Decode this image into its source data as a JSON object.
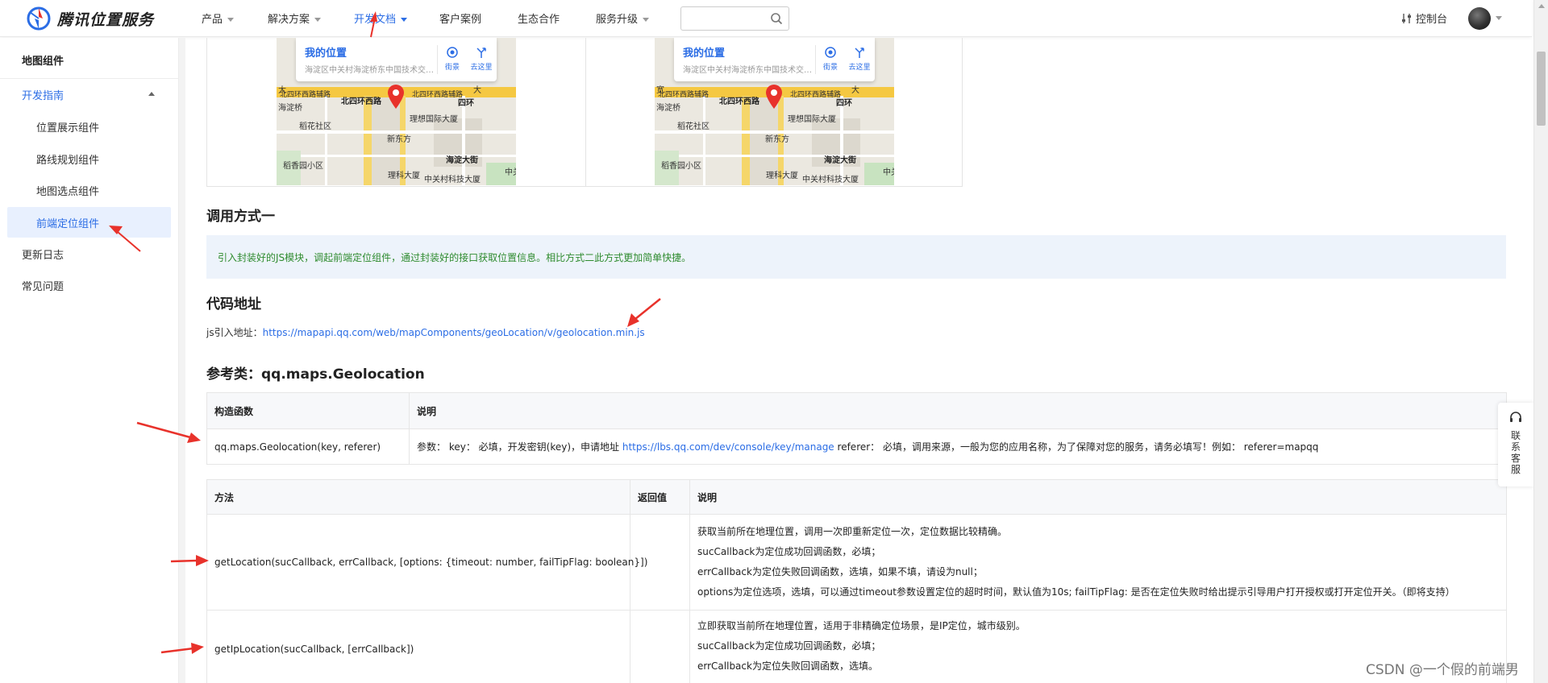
{
  "brand": {
    "name": "腾讯位置服务"
  },
  "nav": {
    "items": [
      {
        "label": "产品",
        "caret": true
      },
      {
        "label": "解决方案",
        "caret": true
      },
      {
        "label": "开发文档",
        "caret": true,
        "active": true
      },
      {
        "label": "客户案例",
        "caret": false
      },
      {
        "label": "生态合作",
        "caret": false
      },
      {
        "label": "服务升级",
        "caret": true
      }
    ],
    "search": {
      "value": "",
      "placeholder": ""
    },
    "console_label": "控制台"
  },
  "sidebar": {
    "title": "地图组件",
    "group": "开发指南",
    "items": [
      "位置展示组件",
      "路线规划组件",
      "地图选点组件",
      "前端定位组件"
    ],
    "active_item": "前端定位组件",
    "bottom_items": [
      "更新日志",
      "常见问题"
    ]
  },
  "maps": [
    {
      "card_title": "我的位置",
      "card_address": "海淀区中关村海淀桥东中国技术交易大厦",
      "btn_street": "街景",
      "btn_go": "去这里",
      "labels": {
        "road_north": "北四环西路辅路",
        "road_north2": "北四环西路辅路",
        "ring": "四环",
        "haidian_bridge": "海淀桥",
        "bridge_w": "北四环西路",
        "daoxiang": "稻花社区",
        "xdf": "新东方",
        "lixiang": "理想国际大厦",
        "haidian_st": "海淀大街",
        "zhixiang": "稻香园小区",
        "kejidasha": "理科大厦",
        "zhongguan": "中关村科技大厦",
        "kuan": "宽",
        "big": "大",
        "zhongguancun": "中关"
      }
    },
    {
      "card_title": "我的位置",
      "card_address": "海淀区中关村海淀桥东中国技术交易大厦",
      "btn_street": "街景",
      "btn_go": "去这里",
      "labels": {
        "road_north": "北四环西路辅路",
        "road_north2": "北四环西路辅路",
        "ring": "四环",
        "haidian_bridge": "海淀桥",
        "bridge_w": "北四环西路",
        "daoxiang": "稻花社区",
        "xdf": "新东方",
        "lixiang": "理想国际大厦",
        "haidian_st": "海淀大街",
        "zhixiang": "稻香园小区",
        "kejidasha": "理科大厦",
        "zhongguan": "中关村科技大厦",
        "kuan": "宽",
        "big": "大",
        "zhongguancun": "中关"
      }
    }
  ],
  "section_call": {
    "title": "调用方式一",
    "notice": "引入封装好的JS模块，调起前端定位组件，通过封装好的接口获取位置信息。相比方式二此方式更加简单快捷。"
  },
  "section_code": {
    "title": "代码地址",
    "js_label": "js引入地址：",
    "js_url": "https://mapapi.qq.com/web/mapComponents/geoLocation/v/geolocation.min.js"
  },
  "section_ref": {
    "title": "参考类：qq.maps.Geolocation",
    "ctor_table": {
      "headers": [
        "构造函数",
        "说明"
      ],
      "row": {
        "ctor": "qq.maps.Geolocation(key, referer)",
        "desc_prefix": "参数： key： 必填，开发密钥(key)，申请地址",
        "desc_link": "https://lbs.qq.com/dev/console/key/manage",
        "desc_suffix": "referer： 必填，调用来源，一般为您的应用名称，为了保障对您的服务，请务必填写！例如： referer=mapqq"
      }
    },
    "method_table": {
      "headers": [
        "方法",
        "返回值",
        "说明"
      ],
      "rows": [
        {
          "method": "getLocation(sucCallback, errCallback, [options: {timeout: number, failTipFlag: boolean}])",
          "ret": "",
          "lines": [
            "获取当前所在地理位置，调用一次即重新定位一次，定位数据比较精确。",
            "sucCallback为定位成功回调函数，必填；",
            "errCallback为定位失败回调函数，选填，如果不填，请设为null；",
            "options为定位选项，选填，可以通过timeout参数设置定位的超时时间，默认值为10s; failTipFlag: 是否在定位失败时给出提示引导用户打开授权或打开定位开关。（即将支持）"
          ]
        },
        {
          "method": "getIpLocation(sucCallback, [errCallback])",
          "ret": "",
          "lines": [
            "立即获取当前所在地理位置，适用于非精确定位场景，是IP定位，城市级别。",
            "sucCallback为定位成功回调函数，必填；",
            "errCallback为定位失败回调函数，选填。"
          ]
        }
      ]
    }
  },
  "service_widget": {
    "label": "联系客服"
  },
  "watermark": "CSDN @一个假的前端男",
  "colors": {
    "accent": "#2b6de5",
    "notice_text": "#2e8b2e",
    "notice_bg": "#edf3fb",
    "arrow": "#e8322b"
  }
}
